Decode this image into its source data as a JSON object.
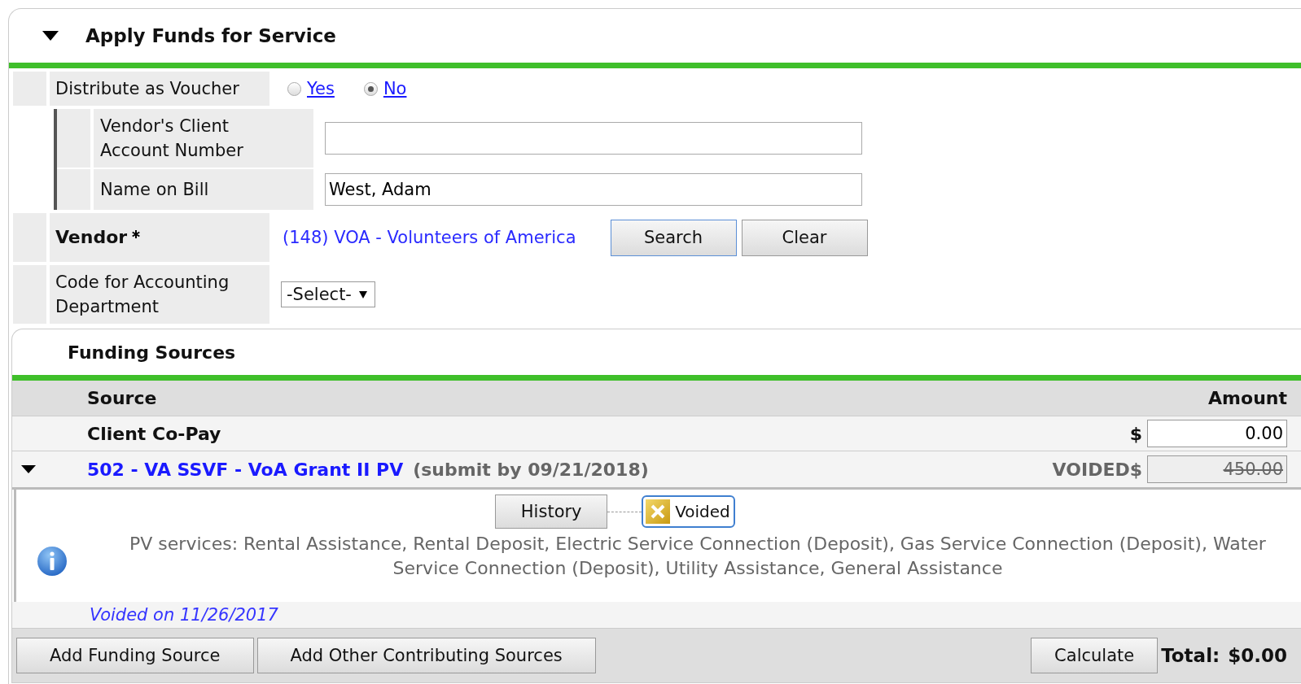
{
  "section": {
    "title": "Apply Funds for Service",
    "expanded": true
  },
  "voucher": {
    "label": "Distribute as Voucher",
    "options": [
      {
        "label": "Yes",
        "selected": false
      },
      {
        "label": "No",
        "selected": true
      }
    ]
  },
  "voucher_fields": [
    {
      "label": "Vendor's Client Account Number"
    },
    {
      "label": "Name on Bill",
      "value": "West, Adam"
    }
  ],
  "vendor": {
    "label": "Vendor",
    "required": true,
    "value": "(148) VOA - Volunteers of America",
    "buttons": [
      {
        "label": "Search",
        "focused": true
      },
      {
        "label": "Clear",
        "focused": false
      }
    ]
  },
  "accounting_code": {
    "label": "Code for Accounting Department",
    "value": "-Select-"
  },
  "funding_sources": {
    "title": "Funding Sources",
    "columns": [
      "Source",
      "Amount"
    ],
    "rows": [
      {
        "kind": "copay",
        "source": "Client Co-Pay",
        "currency": "$",
        "amount": "0.00",
        "voided": false
      },
      {
        "kind": "grant",
        "source": "502 - VA SSVF - VoA Grant II PV",
        "note": "(submit by 09/21/2018)",
        "currency": "VOIDED$",
        "amount": "450.00",
        "voided": true,
        "expanded": true,
        "history_button": "History",
        "status": "Voided",
        "services": "PV services: Rental Assistance, Rental Deposit, Electric Service Connection (Deposit), Gas Service Connection (Deposit), Water Service Connection (Deposit), Utility Assistance, General Assistance",
        "voided_on": "Voided on 11/26/2017"
      }
    ]
  },
  "footer": {
    "buttons": [
      "Add Funding Source",
      "Add Other Contributing Sources"
    ],
    "calculate_button": "Calculate",
    "total_label": "Total:",
    "total_value": "$0.00"
  }
}
